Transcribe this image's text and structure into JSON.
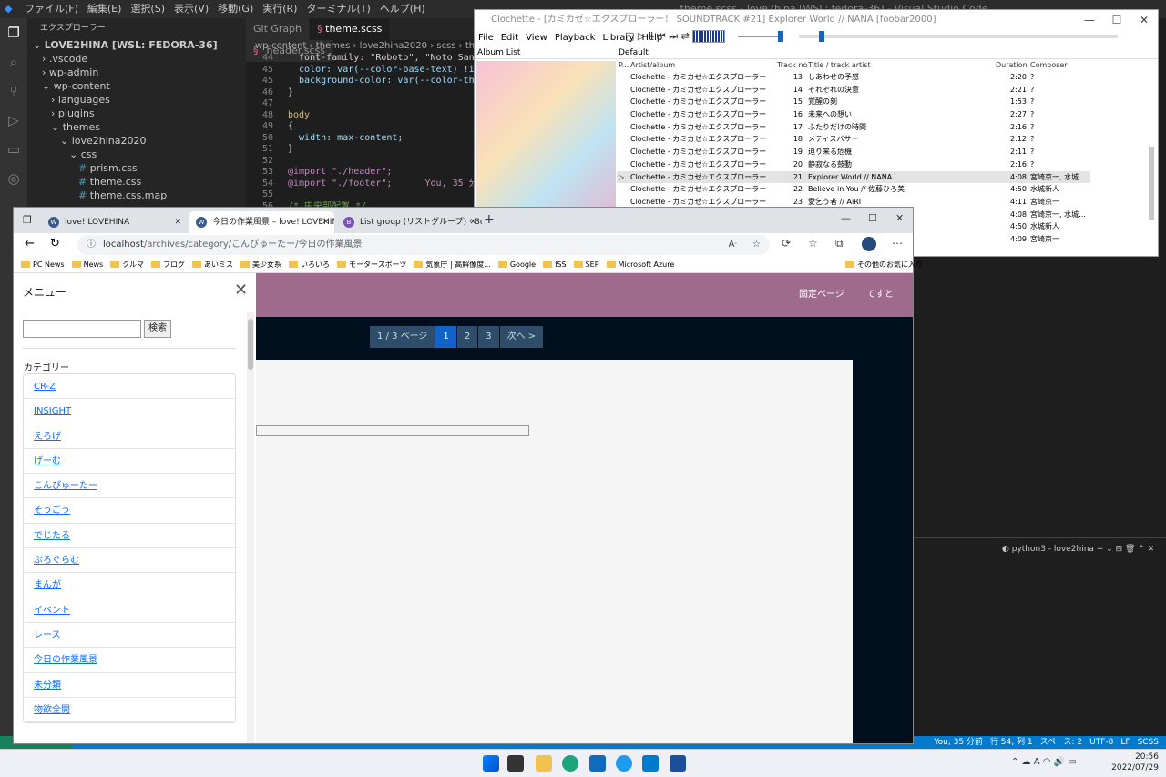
{
  "vscode": {
    "title": "theme.scss - love2hina [WSL: fedora-36] - Visual Studio Code",
    "menu": [
      "ファイル(F)",
      "編集(E)",
      "選択(S)",
      "表示(V)",
      "移動(G)",
      "実行(R)",
      "ターミナル(T)",
      "ヘルプ(H)"
    ],
    "explorer_header": "エクスプローラー",
    "tree": [
      {
        "label": "LOVE2HINA [WSL: FEDORA-36]",
        "indent": 0,
        "kind": "root"
      },
      {
        "label": ".vscode",
        "indent": 1,
        "kind": "folder"
      },
      {
        "label": "wp-admin",
        "indent": 1,
        "kind": "folder"
      },
      {
        "label": "wp-content",
        "indent": 1,
        "kind": "folder-open"
      },
      {
        "label": "languages",
        "indent": 2,
        "kind": "folder"
      },
      {
        "label": "plugins",
        "indent": 2,
        "kind": "folder"
      },
      {
        "label": "themes",
        "indent": 2,
        "kind": "folder-open"
      },
      {
        "label": "love2hina2020",
        "indent": 3,
        "kind": "folder-open"
      },
      {
        "label": "css",
        "indent": 4,
        "kind": "folder-open"
      },
      {
        "label": "prism.css",
        "indent": 5,
        "kind": "file"
      },
      {
        "label": "theme.css",
        "indent": 5,
        "kind": "file"
      },
      {
        "label": "theme.css.map",
        "indent": 5,
        "kind": "file"
      }
    ],
    "tabs": [
      "Git Graph",
      "theme.scss",
      "_header.scss"
    ],
    "breadcrumb": "wp-content › themes › love2hina2020 › scss › theme.scss",
    "code": [
      {
        "n": "44",
        "t": "  font-family: \"Roboto\", \"Noto Sans CJK JP\"",
        "c": "pl"
      },
      {
        "n": "45",
        "t": "  color: var(--color-base-text) !important;",
        "c": "pr"
      },
      {
        "n": "45",
        "t": "  background-color: var(--color-theme-dark);",
        "c": "pr"
      },
      {
        "n": "46",
        "t": "}",
        "c": "pl"
      },
      {
        "n": "47",
        "t": "",
        "c": "pl"
      },
      {
        "n": "48",
        "t": "body",
        "c": "sel"
      },
      {
        "n": "49",
        "t": "{",
        "c": "pl"
      },
      {
        "n": "50",
        "t": "  width: max-content;",
        "c": "pr"
      },
      {
        "n": "51",
        "t": "}",
        "c": "pl"
      },
      {
        "n": "52",
        "t": "",
        "c": "pl"
      },
      {
        "n": "53",
        "t": "@import \"./header\";",
        "c": "kw"
      },
      {
        "n": "54",
        "t": "@import \"./footer\";      You, 35 分前 •",
        "c": "kw"
      },
      {
        "n": "55",
        "t": "",
        "c": "pl"
      },
      {
        "n": "56",
        "t": "/* 中央部配置 */",
        "c": "cm"
      }
    ],
    "terminal_tab": "python3 - love2hina",
    "status": [
      "You, 35 分前",
      "行 54, 列 1",
      "スペース: 2",
      "UTF-8",
      "LF",
      "SCSS"
    ]
  },
  "foobar": {
    "title": "Clochette - [カミカゼ☆エクスプローラー！ SOUNDTRACK #21] Explorer World // NANA  [foobar2000]",
    "menu": [
      "File",
      "Edit",
      "View",
      "Playback",
      "Library",
      "Help"
    ],
    "panel_album": "Album List",
    "panel_default": "Default",
    "columns": [
      "P...",
      "Artist/album",
      "Track no",
      "Title / track artist",
      "Duration",
      "Composer"
    ],
    "rows": [
      {
        "artist": "Clochette - カミカゼ☆エクスプローラー！ SOU...",
        "no": "13",
        "title": "しあわせの予感",
        "dur": "2:20",
        "comp": "?"
      },
      {
        "artist": "Clochette - カミカゼ☆エクスプローラー！ SOU...",
        "no": "14",
        "title": "それぞれの決意",
        "dur": "2:21",
        "comp": "?"
      },
      {
        "artist": "Clochette - カミカゼ☆エクスプローラー！ SOU...",
        "no": "15",
        "title": "覚醒の刻",
        "dur": "1:53",
        "comp": "?"
      },
      {
        "artist": "Clochette - カミカゼ☆エクスプローラー！ SOU...",
        "no": "16",
        "title": "未来への想い",
        "dur": "2:27",
        "comp": "?"
      },
      {
        "artist": "Clochette - カミカゼ☆エクスプローラー！ SOU...",
        "no": "17",
        "title": "ふたりだけの時間",
        "dur": "2:16",
        "comp": "?"
      },
      {
        "artist": "Clochette - カミカゼ☆エクスプローラー！ SOU...",
        "no": "18",
        "title": "メティスバサー",
        "dur": "2:12",
        "comp": "?"
      },
      {
        "artist": "Clochette - カミカゼ☆エクスプローラー！ SOU...",
        "no": "19",
        "title": "迫り来る危機",
        "dur": "2:11",
        "comp": "?"
      },
      {
        "artist": "Clochette - カミカゼ☆エクスプローラー！ SOU...",
        "no": "20",
        "title": "静寂なる鼓動",
        "dur": "2:16",
        "comp": "?"
      },
      {
        "artist": "Clochette - カミカゼ☆エクスプローラー！ SOU...",
        "no": "21",
        "title": "Explorer World // NANA",
        "dur": "4:08",
        "comp": "宮崎京一, 水城...",
        "playing": true
      },
      {
        "artist": "Clochette - カミカゼ☆エクスプローラー！ SOU...",
        "no": "22",
        "title": "Believe in You // 佐藤ひろ美",
        "dur": "4:50",
        "comp": "水城新人"
      },
      {
        "artist": "Clochette - カミカゼ☆エクスプローラー！ SOU...",
        "no": "23",
        "title": "愛乞う者 // AiRI",
        "dur": "4:11",
        "comp": "宮崎京一"
      },
      {
        "artist": "",
        "no": "",
        "title": "",
        "dur": "4:08",
        "comp": "宮崎京一, 水城..."
      },
      {
        "artist": "",
        "no": "",
        "title": "",
        "dur": "4:50",
        "comp": "水城新人"
      },
      {
        "artist": "",
        "no": "",
        "title": "",
        "dur": "4:09",
        "comp": "宮崎京一"
      }
    ]
  },
  "edge": {
    "tabs": [
      {
        "label": "love! LOVEHINA",
        "icon": "W"
      },
      {
        "label": "今日の作業風景 – love! LOVEHINA",
        "icon": "W"
      },
      {
        "label": "List group (リストグループ) · Bootstra",
        "icon": "B"
      }
    ],
    "url_host": "localhost",
    "url_path": "/archives/category/こんぴゅーたー/今日の作業風景",
    "favorites": [
      "PC News",
      "News",
      "クルマ",
      "ブログ",
      "あいミス",
      "美少女系",
      "いろいろ",
      "モータースポーツ",
      "気象庁 | 高解像度...",
      "Google",
      "ISS",
      "SEP",
      "Microsoft Azure"
    ],
    "other_favorites": "その他のお気に入り"
  },
  "page": {
    "nav": [
      "固定ページ",
      "てすと"
    ],
    "pager": [
      "1 / 3 ページ",
      "1",
      "2",
      "3",
      "次へ >"
    ],
    "drawer_title": "メニュー",
    "search_button": "検索",
    "category_heading": "カテゴリー",
    "categories": [
      "CR-Z",
      "INSIGHT",
      "えろげ",
      "げーむ",
      "こんぴゅーたー",
      "そうごう",
      "でじたる",
      "ぷろぐらむ",
      "まんが",
      "イベント",
      "レース",
      "今日の作業風景",
      "未分類",
      "物欲全開"
    ]
  },
  "taskbar": {
    "time": "20:56",
    "date": "2022/07/29"
  },
  "colors": {
    "vs_bg": "#1e1e1e",
    "status_bar": "#007acc",
    "page_header": "#9e6b8c",
    "page_bg": "#000f1e",
    "link": "#0d6efd",
    "pager_active": "#1163c7"
  }
}
